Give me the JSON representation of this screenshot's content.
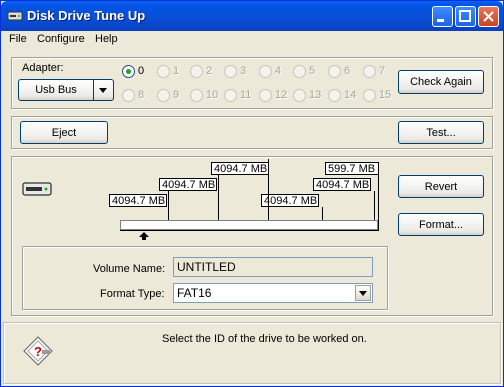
{
  "window": {
    "title": "Disk Drive Tune Up"
  },
  "menu": [
    "File",
    "Configure",
    "Help"
  ],
  "adapter": {
    "label": "Adapter:",
    "selected": "Usb Bus",
    "ids": [
      "0",
      "1",
      "2",
      "3",
      "4",
      "5",
      "6",
      "7",
      "8",
      "9",
      "10",
      "11",
      "12",
      "13",
      "14",
      "15"
    ],
    "selected_id": "0",
    "check_again_label": "Check Again"
  },
  "actions": {
    "eject_label": "Eject",
    "test_label": "Test..."
  },
  "partitions": {
    "sizes": [
      "4094.7 MB",
      "4094.7 MB",
      "4094.7 MB",
      "4094.7 MB",
      "4094.7 MB",
      "599.7 MB"
    ],
    "revert_label": "Revert",
    "format_label": "Format..."
  },
  "volume": {
    "name_label": "Volume Name:",
    "name_value": "UNTITLED",
    "type_label": "Format Type:",
    "type_value": "FAT16"
  },
  "status": {
    "message": "Select the ID of the drive to be worked on."
  },
  "colors": {
    "titlebar": "#0a4fd6",
    "window_bg": "#ece9d8",
    "selected_radio": "#21a121"
  }
}
